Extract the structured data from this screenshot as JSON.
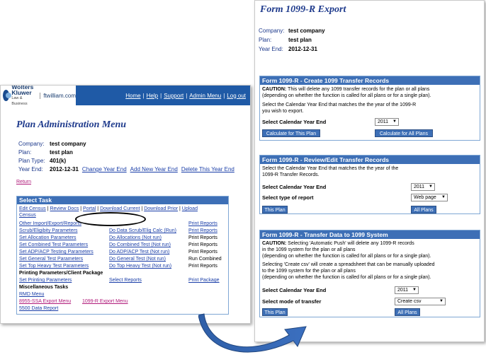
{
  "left": {
    "logo": {
      "name": "Wolters Kluwer",
      "sub": "Law & Business",
      "site": "ftwilliam.com"
    },
    "topnav": [
      "Home",
      "Help",
      "Support",
      "Admin Menu",
      "Log out"
    ],
    "title": "Plan Administration Menu",
    "company_label": "Company:",
    "company_value": "test company",
    "plan_label": "Plan:",
    "plan_value": "test plan",
    "plantype_label": "Plan Type:",
    "plantype_value": "401(k)",
    "yearend_label": "Year End:",
    "yearend_value": "2012-12-31",
    "yearend_links": [
      "Change Year End",
      "Add New Year End",
      "Delete This Year End"
    ],
    "return": "Return",
    "task_header": "Select Task",
    "task_row1": [
      "Edit Census",
      "Review Docs",
      "Portal",
      "Download Current",
      "Download Prior",
      "Upload"
    ],
    "census": "Census",
    "other_import": "Other Import/Export/Reports",
    "rows": [
      {
        "a": "Scrub/Eligibity Parameters",
        "b": "Do Data Scrub/Elig Calc (Run)",
        "c": "Print Reports"
      },
      {
        "a": "Set Allocation Parameters",
        "b": "Do Allocations (Not run)",
        "c": "Print Reports"
      },
      {
        "a": "Set Combined Test Parameters",
        "b": "Do Combined Test (Not run)",
        "c": "Print Reports"
      },
      {
        "a": "Set ADP/ACP Testing Parameters",
        "b": "Do ADP/ACP Test (Not run)",
        "c": "Print Reports"
      },
      {
        "a": "Set General Test Parameters",
        "b": "Do General Test (Not run)",
        "c": "Run Combined"
      },
      {
        "a": "Set Top Heavy Test Parameters",
        "b": "Do Top Heavy Test (Not run)",
        "c": "Print Reports"
      }
    ],
    "print_reports_top": "Print Reports",
    "printing_header": "Printing Parameters/Client Package",
    "set_printing": "Set Printing Parameters",
    "select_reports": "Select Reports",
    "print_package": "Print Package",
    "misc_header": "Miscellaneous Tasks",
    "rmd_menu": "RMD Menu",
    "ssa_menu": "8955-SSA Export Menu",
    "export_1099": "1099-R Export Menu",
    "data_5500": "5500 Data Report"
  },
  "right": {
    "title": "Form 1099-R Export",
    "company_label": "Company:",
    "company_value": "test company",
    "plan_label": "Plan:",
    "plan_value": "test plan",
    "yearend_label": "Year End:",
    "yearend_value": "2012-12-31",
    "box1": {
      "header": "Form 1099-R - Create 1099 Transfer Records",
      "caution_label": "CAUTION:",
      "caution_l1": " This will delete any 1099 transfer records for the plan or all plans",
      "caution_l2": "(depending on whether the function is called for all plans or for a single plan).",
      "select_l1": "Select the Calendar Year End that matches the the year of the 1099-R",
      "select_l2": "you wish to export.",
      "year_label": "Select Calendar Year End",
      "year_value": "2011",
      "btn_plan": "Calculate for This Plan",
      "btn_all": "Calculate for All Plans"
    },
    "box2": {
      "header": "Form 1099-R - Review/Edit Transfer Records",
      "select_l1": "Select the Calendar Year End that matches the the year of the",
      "select_l2": "1099-R Transfer Records.",
      "year_label": "Select Calendar Year End",
      "year_value": "2011",
      "type_label": "Select type of report",
      "type_value": "Web page",
      "btn_plan": "This Plan",
      "btn_all": "All Plans"
    },
    "box3": {
      "header": "Form 1099-R - Transfer Data to 1099 System",
      "caution_label": "CAUTION:",
      "caution_l1": " Selecting 'Automatic Push' will delete any 1099-R records",
      "caution_l2": "in the 1099 system for the plan or all plans",
      "caution_l3": "(depending on whether the function is called for all plans or for a single plan).",
      "csv_l1": "Selecting 'Create csv' will create a spreadsheet that can be manually uploaded",
      "csv_l2": "to the 1099 system for the plan or all plans",
      "csv_l3": "(depending on whether the function is called for all plans or for a single plan).",
      "year_label": "Select Calendar Year End",
      "year_value": "2011",
      "mode_label": "Select mode of transfer",
      "mode_value": "Create csv",
      "btn_plan": "This Plan",
      "btn_all": "All Plans"
    }
  },
  "colors": {
    "header_blue": "#3d6fb6",
    "title_blue": "#1e3a8c",
    "nav_blue": "#1f5aa6"
  }
}
